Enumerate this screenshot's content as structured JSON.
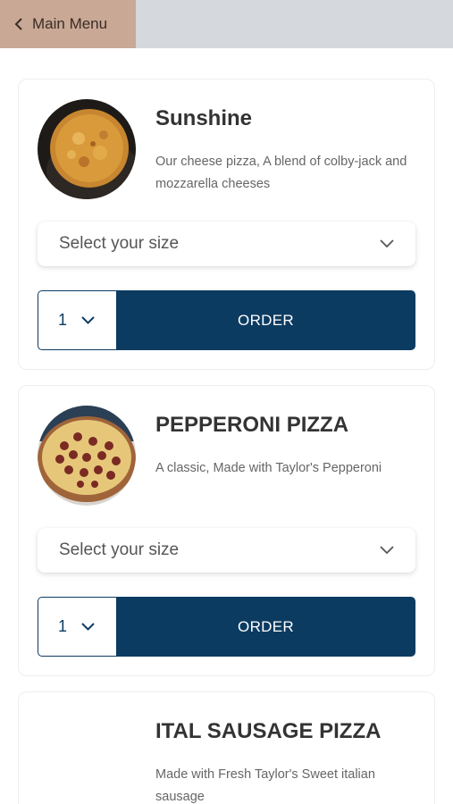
{
  "nav": {
    "back_label": "Main Menu",
    "back_icon": "chevron-left-icon"
  },
  "colors": {
    "accent": "#0c3b61",
    "back_button_bg": "#c9a895",
    "topbar_bg": "#d5d8dc"
  },
  "menu_items": [
    {
      "name": "Sunshine",
      "description": "Our cheese pizza, A blend of colby-jack and mozzarella cheeses",
      "size_placeholder": "Select your size",
      "quantity": "1",
      "order_label": "ORDER",
      "image": "cheese-pizza-photo"
    },
    {
      "name": "PEPPERONI PIZZA",
      "description": "A classic, Made with Taylor's Pepperoni",
      "size_placeholder": "Select your size",
      "quantity": "1",
      "order_label": "ORDER",
      "image": "pepperoni-pizza-photo"
    },
    {
      "name": "ITAL SAUSAGE PIZZA",
      "description": "Made with Fresh Taylor's Sweet italian sausage"
    }
  ]
}
